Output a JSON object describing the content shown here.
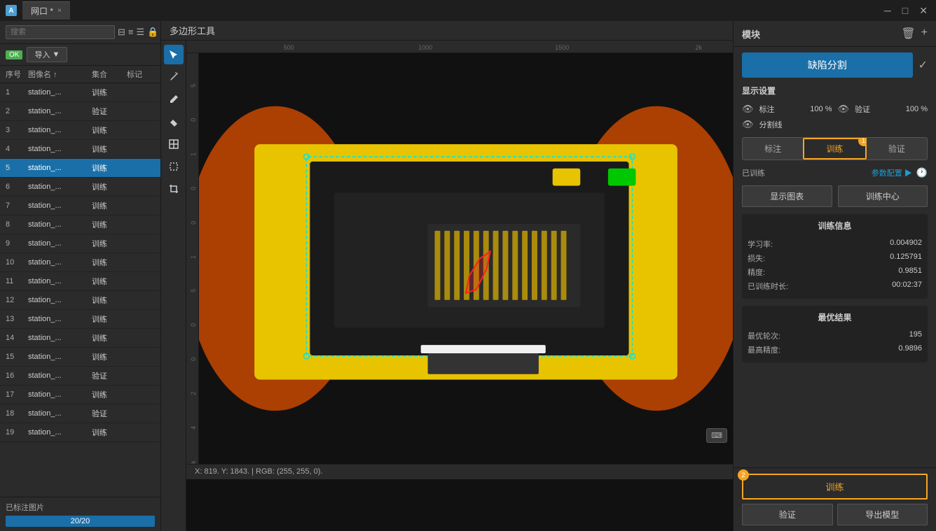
{
  "titlebar": {
    "icon": "A",
    "tab_label": "网口 *",
    "close": "×"
  },
  "toolbar_title": "多边形工具",
  "sidebar": {
    "search_placeholder": "搜索",
    "import_label": "导入",
    "ok_badge": "OK",
    "columns": [
      "序号",
      "图像名 ↑",
      "集合",
      "标记"
    ],
    "rows": [
      {
        "num": 1,
        "name": "station_...",
        "set": "训练",
        "mark": ""
      },
      {
        "num": 2,
        "name": "station_...",
        "set": "验证",
        "mark": ""
      },
      {
        "num": 3,
        "name": "station_...",
        "set": "训练",
        "mark": ""
      },
      {
        "num": 4,
        "name": "station_...",
        "set": "训练",
        "mark": ""
      },
      {
        "num": 5,
        "name": "station_...",
        "set": "训练",
        "mark": "",
        "active": true
      },
      {
        "num": 6,
        "name": "station_...",
        "set": "训练",
        "mark": ""
      },
      {
        "num": 7,
        "name": "station_...",
        "set": "训练",
        "mark": ""
      },
      {
        "num": 8,
        "name": "station_...",
        "set": "训练",
        "mark": ""
      },
      {
        "num": 9,
        "name": "station_...",
        "set": "训练",
        "mark": ""
      },
      {
        "num": 10,
        "name": "station_...",
        "set": "训练",
        "mark": ""
      },
      {
        "num": 11,
        "name": "station_...",
        "set": "训练",
        "mark": ""
      },
      {
        "num": 12,
        "name": "station_...",
        "set": "训练",
        "mark": ""
      },
      {
        "num": 13,
        "name": "station_...",
        "set": "训练",
        "mark": ""
      },
      {
        "num": 14,
        "name": "station_...",
        "set": "训练",
        "mark": ""
      },
      {
        "num": 15,
        "name": "station_...",
        "set": "训练",
        "mark": ""
      },
      {
        "num": 16,
        "name": "station_...",
        "set": "验证",
        "mark": ""
      },
      {
        "num": 17,
        "name": "station_...",
        "set": "训练",
        "mark": ""
      },
      {
        "num": 18,
        "name": "station_...",
        "set": "验证",
        "mark": ""
      },
      {
        "num": 19,
        "name": "station_...",
        "set": "训练",
        "mark": ""
      }
    ],
    "footer_label": "已标注图片",
    "progress_text": "20/20"
  },
  "canvas": {
    "ruler_h_marks": [
      "",
      "500",
      "",
      "1000",
      "",
      "1500",
      "",
      "2k"
    ],
    "ruler_v_marks": [
      "5",
      "0",
      "1",
      "0",
      "0",
      "1",
      "5",
      "0",
      "0",
      "2",
      "4",
      "k"
    ],
    "status_text": "X: 819. Y: 1843. | RGB: (255, 255, 0)."
  },
  "right_panel": {
    "title": "模块",
    "add_icon": "+",
    "delete_icon": "🗑",
    "defect_btn": "缺陷分割",
    "check_icon": "✓",
    "display_settings_title": "显示设置",
    "label_eye": "👁",
    "label_text": "标注",
    "label_pct": "100 %",
    "verify_eye": "👁",
    "verify_text": "验证",
    "verify_pct": "100 %",
    "divider_eye": "👁",
    "divider_text": "分割线",
    "tab_label": "标注",
    "tab_train": "训练",
    "tab_verify": "验证",
    "badge_num": "1",
    "trained_label": "已训练",
    "params_link": "参数配置 ▶",
    "show_chart": "显示图表",
    "train_center": "训练中心",
    "train_info_title": "训练信息",
    "lr_label": "学习率:",
    "lr_value": "0.004902",
    "loss_label": "损失:",
    "loss_value": "0.125791",
    "acc_label": "精度:",
    "acc_value": "0.9851",
    "trained_time_label": "已训练时长:",
    "trained_time_value": "00:02:37",
    "best_result_title": "最优结果",
    "best_epoch_label": "最优轮次:",
    "best_epoch_value": "195",
    "best_acc_label": "最高精度:",
    "best_acc_value": "0.9896",
    "footer_train_btn": "训练",
    "badge2_num": "2",
    "footer_verify_btn": "验证",
    "footer_export_btn": "导出模型"
  }
}
